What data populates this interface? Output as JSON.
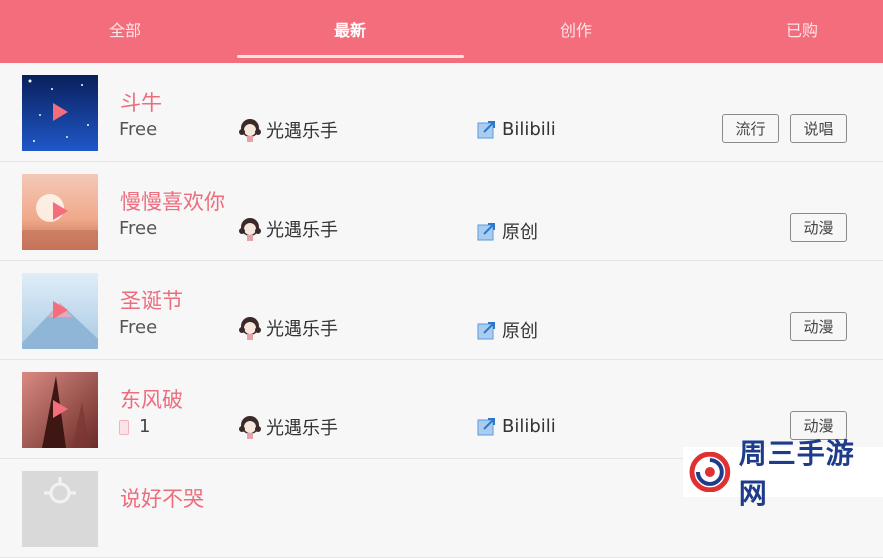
{
  "tabs": [
    {
      "label": "全部"
    },
    {
      "label": "最新"
    },
    {
      "label": "创作"
    },
    {
      "label": "已购"
    }
  ],
  "active_tab": "最新",
  "songs": [
    {
      "title": "斗牛",
      "price": "Free",
      "author": "光遇乐手",
      "source": "Bilibili",
      "tags": [
        "流行",
        "说唱"
      ]
    },
    {
      "title": "慢慢喜欢你",
      "price": "Free",
      "author": "光遇乐手",
      "source": "原创",
      "tags": [
        "动漫"
      ]
    },
    {
      "title": "圣诞节",
      "price": "Free",
      "author": "光遇乐手",
      "source": "原创",
      "tags": [
        "动漫"
      ]
    },
    {
      "title": "东风破",
      "price": "1",
      "author": "光遇乐手",
      "source": "Bilibili",
      "tags": [
        "动漫"
      ]
    },
    {
      "title": "说好不哭"
    }
  ],
  "watermark": {
    "text": "周三手游网"
  },
  "colors": {
    "accent": "#f36d7c",
    "title": "#ec6d7e",
    "background": "#f7f7f7"
  }
}
